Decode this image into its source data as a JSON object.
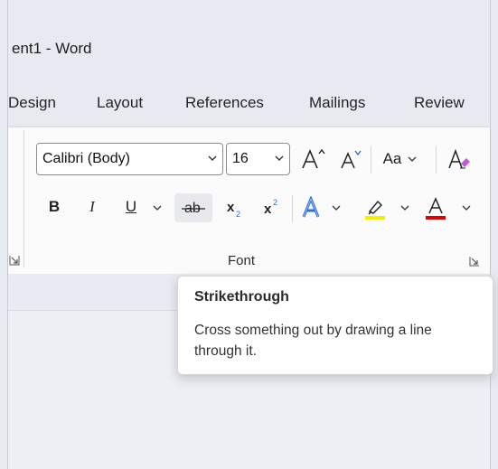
{
  "window": {
    "title": "ent1  -  Word"
  },
  "tabs": [
    "Design",
    "Layout",
    "References",
    "Mailings",
    "Review"
  ],
  "ribbon": {
    "font_name": "Calibri (Body)",
    "font_size": "16",
    "change_case_label": "Aa",
    "group_label": "Font",
    "highlight_color": "#f4ee00",
    "font_color": "#e00000"
  },
  "tooltip": {
    "title": "Strikethrough",
    "description": "Cross something out by drawing a line through it."
  }
}
